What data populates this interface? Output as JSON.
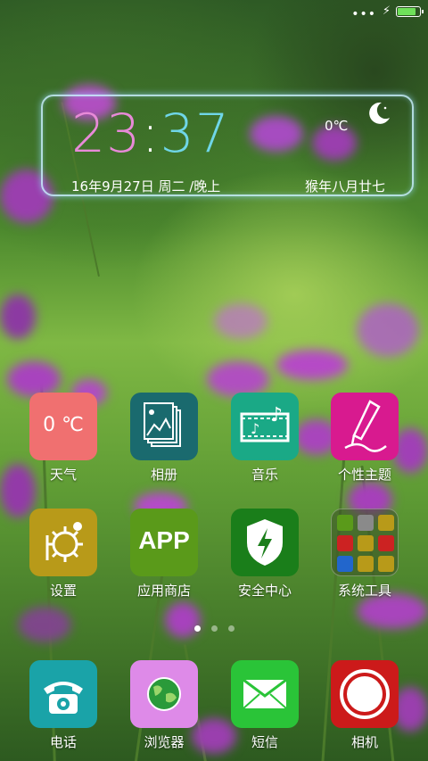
{
  "status_bar": {
    "signal_icon": "dots-icon",
    "charging_icon": "bolt-icon",
    "battery_level": 0.85,
    "battery_color": "#6fe05a"
  },
  "clock_widget": {
    "time_hh": "23",
    "time_sep": ":",
    "time_mm": "37",
    "temperature": "0℃",
    "weather_icon": "moon-icon",
    "date": "16年9月27日 周二 /晚上",
    "lunar_date": "猴年八月廿七"
  },
  "apps": [
    {
      "id": "weather",
      "label": "天气",
      "icon": "weather-icon",
      "icon_text": "0 ℃",
      "color": "#f07070"
    },
    {
      "id": "gallery",
      "label": "相册",
      "icon": "gallery-icon",
      "color": "#1a6a6e"
    },
    {
      "id": "music",
      "label": "音乐",
      "icon": "music-icon",
      "color": "#1aa986"
    },
    {
      "id": "themes",
      "label": "个性主题",
      "icon": "brush-icon",
      "color": "#d81a8f"
    },
    {
      "id": "settings",
      "label": "设置",
      "icon": "gear-icon",
      "color": "#b89a19"
    },
    {
      "id": "appstore",
      "label": "应用商店",
      "icon": "app-store-icon",
      "icon_text": "APP",
      "color": "#5a9a1a"
    },
    {
      "id": "security",
      "label": "安全中心",
      "icon": "shield-icon",
      "color": "#1a7e1a"
    },
    {
      "id": "tools",
      "label": "系统工具",
      "icon": "folder-icon",
      "color": "#4a5a3a"
    }
  ],
  "page_indicator": {
    "count": 3,
    "active": 0
  },
  "dock": [
    {
      "id": "phone",
      "label": "电话",
      "icon": "phone-icon",
      "color": "#1aa3a8"
    },
    {
      "id": "browser",
      "label": "浏览器",
      "icon": "globe-icon",
      "color": "#de8ae8"
    },
    {
      "id": "sms",
      "label": "短信",
      "icon": "envelope-icon",
      "color": "#2ac438"
    },
    {
      "id": "camera",
      "label": "相机",
      "icon": "camera-icon",
      "color": "#cc1a1a"
    }
  ]
}
